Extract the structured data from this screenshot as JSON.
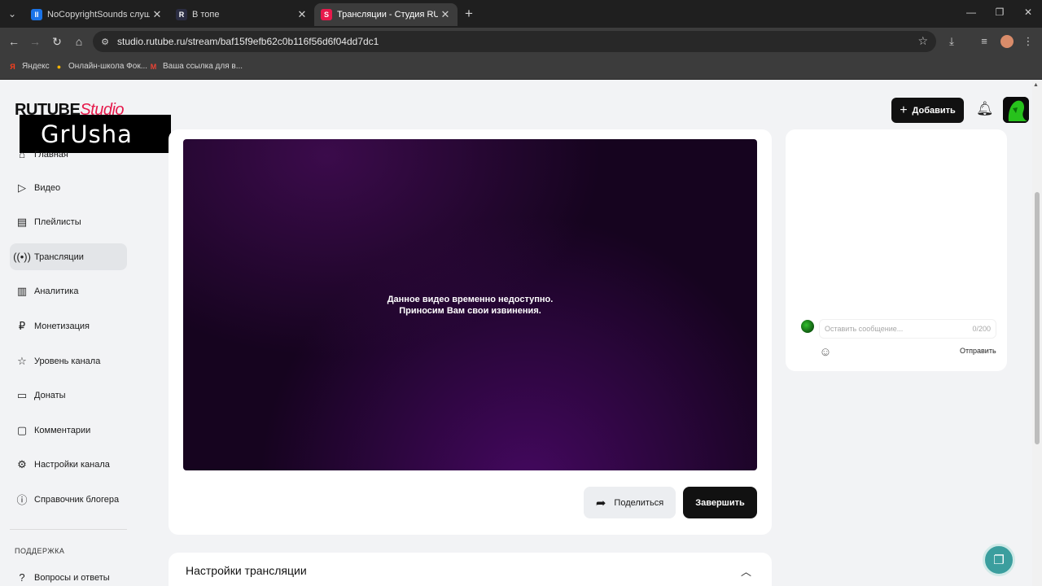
{
  "browser": {
    "tabs": [
      {
        "title": "NoCopyrightSounds слушать о",
        "favicon": "II",
        "favicon_color": "#1a73e8",
        "active": false
      },
      {
        "title": "В топе",
        "favicon": "R",
        "favicon_color": "#2b2d42",
        "active": false
      },
      {
        "title": "Трансляции - Студия RUTUBE",
        "favicon": "S",
        "favicon_color": "#e6194b",
        "active": true
      }
    ],
    "url": "studio.rutube.ru/stream/baf15f9efb62c0b116f56d6f04dd7dc1",
    "bookmarks": [
      {
        "label": "Яндекс",
        "icon": "Я",
        "color": "#fc3f1d"
      },
      {
        "label": "Онлайн-школа Фок...",
        "icon": "●",
        "color": "#f5b400"
      },
      {
        "label": "Ваша ссылка для в...",
        "icon": "M",
        "color": "#ea4335"
      }
    ]
  },
  "studio": {
    "logo_main": "RUTUBE",
    "logo_studio": "Studio",
    "watermark": "GrUsha",
    "header": {
      "add_label": "Добавить"
    },
    "sidebar": {
      "items": [
        {
          "label": "Главная",
          "icon": "home-icon"
        },
        {
          "label": "Видео",
          "icon": "video-icon"
        },
        {
          "label": "Плейлисты",
          "icon": "playlist-icon"
        },
        {
          "label": "Трансляции",
          "icon": "broadcast-icon",
          "active": true
        },
        {
          "label": "Аналитика",
          "icon": "analytics-icon"
        },
        {
          "label": "Монетизация",
          "icon": "ruble-icon"
        },
        {
          "label": "Уровень канала",
          "icon": "star-icon"
        },
        {
          "label": "Донаты",
          "icon": "wallet-icon"
        },
        {
          "label": "Комментарии",
          "icon": "comment-icon"
        },
        {
          "label": "Настройки канала",
          "icon": "gear-icon"
        },
        {
          "label": "Справочник блогера",
          "icon": "info-icon"
        }
      ],
      "support_heading": "ПОДДЕРЖКА",
      "support_items": [
        {
          "label": "Вопросы и ответы",
          "icon": "help-icon"
        }
      ]
    },
    "player": {
      "message_line1": "Данное видео временно недоступно.",
      "message_line2": "Приносим Вам свои извинения."
    },
    "actions": {
      "share_label": "Поделиться",
      "finish_label": "Завершить"
    },
    "settings": {
      "title": "Настройки трансляции"
    },
    "chat": {
      "placeholder": "Оставить сообщение...",
      "counter": "0/200",
      "send_label": "Отправить"
    }
  },
  "colors": {
    "accent": "#e6194b",
    "fab": "#3b9e9e",
    "dark_button": "#111111"
  }
}
